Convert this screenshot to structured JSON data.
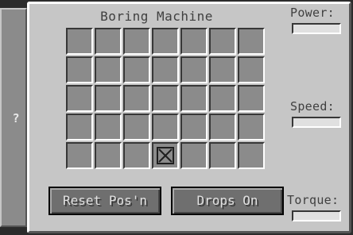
{
  "side_tab": {
    "help_label": "?"
  },
  "machine": {
    "title": "Boring Machine"
  },
  "grid": {
    "rows": 5,
    "cols": 7,
    "marked_cell": {
      "row": 5,
      "col": 4
    }
  },
  "buttons": {
    "reset_label": "Reset Pos'n",
    "drops_label": "Drops On"
  },
  "stats": {
    "power_label": "Power:",
    "speed_label": "Speed:",
    "torque_label": "Torque:",
    "power_level": 0,
    "speed_level": 0,
    "torque_level": 0
  },
  "colors": {
    "panel": "#c6c6c6",
    "slot": "#8b8b8b",
    "button": "#6f6f6f",
    "text": "#404040"
  }
}
